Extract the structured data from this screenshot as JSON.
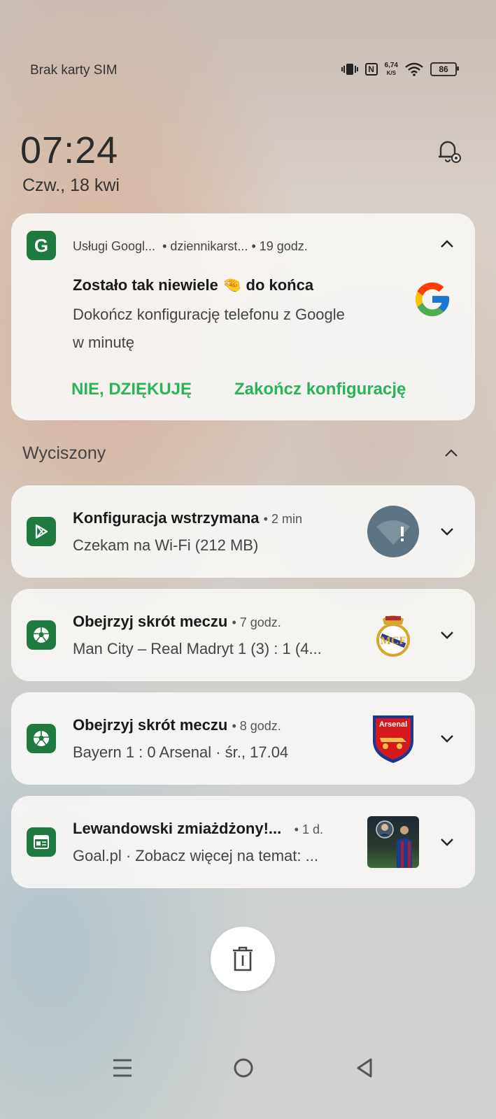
{
  "status": {
    "carrier": "Brak karty SIM",
    "speed_value": "6,74",
    "speed_unit": "K/S",
    "battery": "86",
    "icons": [
      "vibrate-icon",
      "nfc-icon",
      "wifi-icon",
      "battery-icon"
    ]
  },
  "clock": {
    "time": "07:24",
    "date": "Czw., 18 kwi"
  },
  "google_notification": {
    "app": "Usługi Googl...",
    "account": "dziennikarst...",
    "time": "19 godz.",
    "title_before": "Zostało tak niewiele",
    "title_emoji": "🤏",
    "title_after": "do końca",
    "body_line1": "Dokończ konfigurację telefonu z Google",
    "body_line2": "w minutę",
    "action_decline": "NIE, DZIĘKUJĘ",
    "action_finish": "Zakończ konfigurację"
  },
  "silenced_section": {
    "label": "Wyciszony"
  },
  "notifications": [
    {
      "title": "Konfiguracja wstrzymana",
      "time": "2 min",
      "body": "Czekam na Wi-Fi (212 MB)",
      "icon": "play-store-icon"
    },
    {
      "title": "Obejrzyj skrót meczu",
      "time": "7 godz.",
      "body": "Man City – Real Madryt 1 (3) : 1 (4...",
      "icon": "soccer-ball-icon"
    },
    {
      "title": "Obejrzyj skrót meczu",
      "time": "8 godz.",
      "body": "Bayern 1 : 0 Arsenal · śr., 17.04",
      "icon": "soccer-ball-icon",
      "thumb_text": "Arsenal"
    },
    {
      "title": "Lewandowski zmiażdżony!...",
      "time": "1 d.",
      "body": "Goal.pl · Zobacz więcej na temat: ...",
      "icon": "news-icon"
    }
  ],
  "colors": {
    "accent_green": "#2bb35a",
    "icon_green": "#1e7a3e"
  }
}
